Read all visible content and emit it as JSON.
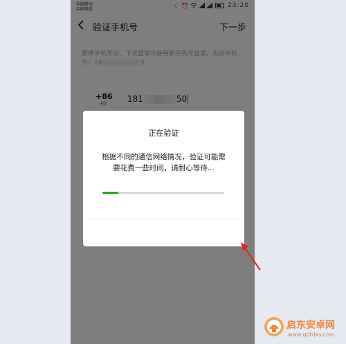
{
  "status_bar": {
    "carrier_1": "中国移动",
    "carrier_2": "中国电信",
    "time": "23:20",
    "icons": [
      "moon-icon",
      "alarm-icon",
      "wifi-icon",
      "signal-icon",
      "signal-icon",
      "battery-icon"
    ]
  },
  "header": {
    "back_icon": "chevron-left-icon",
    "title": "验证手机号",
    "next_label": "下一步"
  },
  "hint": {
    "text": "更换手机号后，下次登录可使用新手机号登录。当前手机号：18",
    "masked_tail": "9"
  },
  "phone_input": {
    "country_code": "+86",
    "country_name": "中国",
    "prefix": "181",
    "suffix": "50"
  },
  "dialog": {
    "title": "正在验证",
    "message": "根据不同的通信网络情况，验证可能需要花费一些时间，请耐心等待...",
    "progress": 0.13
  },
  "watermark": {
    "name": "启东安卓网",
    "url": "www.qdtdxy.com"
  },
  "colors": {
    "accent": "#1aad19",
    "overlay": "rgba(0,0,0,0.48)",
    "annotation_arrow": "#e02020",
    "watermark": "#f0883c"
  }
}
